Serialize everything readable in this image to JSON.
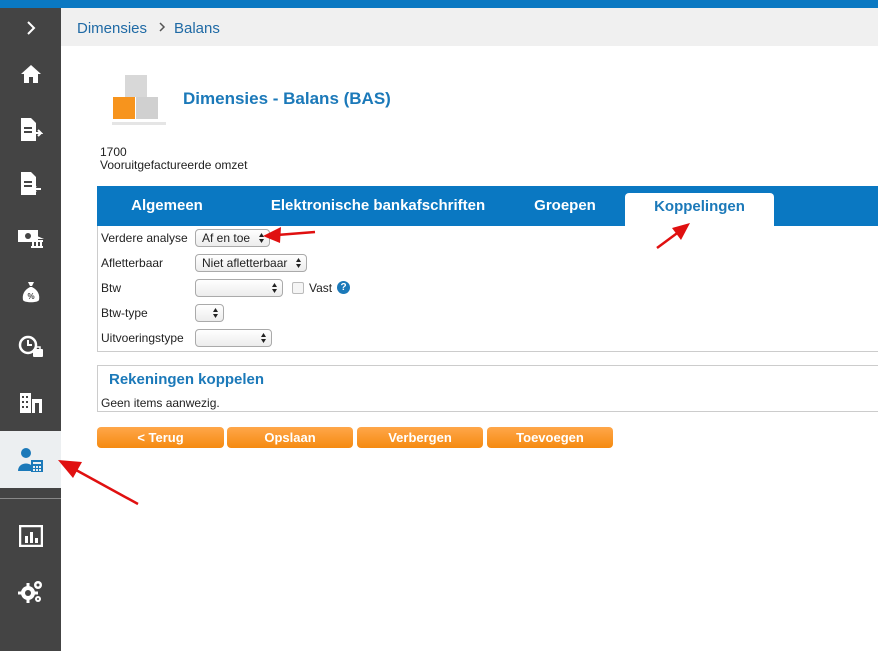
{
  "breadcrumb": {
    "items": [
      "Dimensies",
      "Balans"
    ]
  },
  "header": {
    "title": "Dimensies - Balans (BAS)"
  },
  "account": {
    "code": "1700",
    "name": "Vooruitgefactureerde omzet"
  },
  "tabs": [
    {
      "label": "Algemeen"
    },
    {
      "label": "Elektronische bankafschriften"
    },
    {
      "label": "Groepen"
    },
    {
      "label": "Koppelingen",
      "active": true
    }
  ],
  "form": {
    "verdere_analyse": {
      "label": "Verdere analyse",
      "value": "Af en toe"
    },
    "afletterbaar": {
      "label": "Afletterbaar",
      "value": "Niet afletterbaar"
    },
    "btw": {
      "label": "Btw",
      "value": "",
      "vast_label": "Vast",
      "vast_checked": false,
      "help": "?"
    },
    "btw_type": {
      "label": "Btw-type",
      "value": ""
    },
    "uitvoeringstype": {
      "label": "Uitvoeringstype",
      "value": ""
    }
  },
  "rekeningen": {
    "title": "Rekeningen koppelen",
    "empty_text": "Geen items aanwezig."
  },
  "buttons": {
    "back": "< Terug",
    "save": "Opslaan",
    "hide": "Verbergen",
    "add": "Toevoegen"
  },
  "sidebar": {
    "items": [
      {
        "icon": "chevron-right-icon"
      },
      {
        "icon": "home-icon"
      },
      {
        "icon": "document-outgoing-icon"
      },
      {
        "icon": "document-incoming-icon"
      },
      {
        "icon": "bank-money-icon"
      },
      {
        "icon": "money-bag-icon"
      },
      {
        "icon": "clock-briefcase-icon"
      },
      {
        "icon": "buildings-icon"
      },
      {
        "icon": "user-calculator-icon",
        "active": true
      },
      {
        "icon": "report-chart-icon"
      },
      {
        "icon": "settings-gears-icon"
      }
    ]
  },
  "colors": {
    "brand_blue": "#0a78c2",
    "title_blue": "#1b79b9",
    "button_orange": "#f58a10",
    "sidebar": "#444444",
    "annotation_red": "#e01010"
  }
}
